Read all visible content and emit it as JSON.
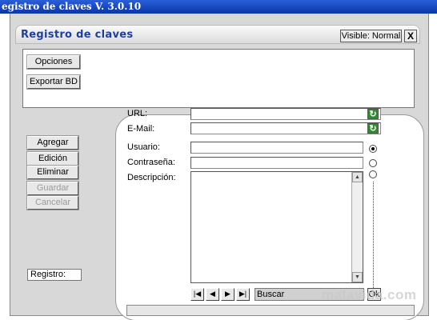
{
  "window": {
    "title": "egistro de claves V. 3.0.10"
  },
  "header": {
    "app_name": "Registro de claves",
    "visible_button": "Visible: Normal",
    "close_button": "X"
  },
  "options": {
    "opciones_button": "Opciones",
    "exportar_button": "Exportar BD"
  },
  "actions": {
    "agregar": "Agregar",
    "edicion": "Edición",
    "eliminar": "Eliminar",
    "guardar": "Guardar",
    "cancelar": "Cancelar"
  },
  "form": {
    "url_label": "URL:",
    "url_value": "",
    "email_label": "E-Mail:",
    "email_value": "",
    "usuario_label": "Usuario:",
    "usuario_value": "",
    "contrasena_label": "Contraseña:",
    "contrasena_value": "",
    "descripcion_label": "Descripción:",
    "descripcion_value": "",
    "radio_selected_index": 0
  },
  "navigation": {
    "first": "|◀",
    "prev": "◀",
    "next": "▶",
    "last": "▶|",
    "search_label": "Buscar",
    "ok_button": "Ok"
  },
  "status": {
    "registro_label": "Registro:",
    "status_text": ""
  },
  "watermark": "malavida.com",
  "icons": {
    "refresh_icon": "refresh-icon",
    "scroll_up": "chevron-up-icon",
    "scroll_down": "chevron-down-icon"
  },
  "colors": {
    "title_bar": "#0a36a8",
    "app_name": "#1f3f9e",
    "refresh_icon": "#2e8b2e"
  }
}
